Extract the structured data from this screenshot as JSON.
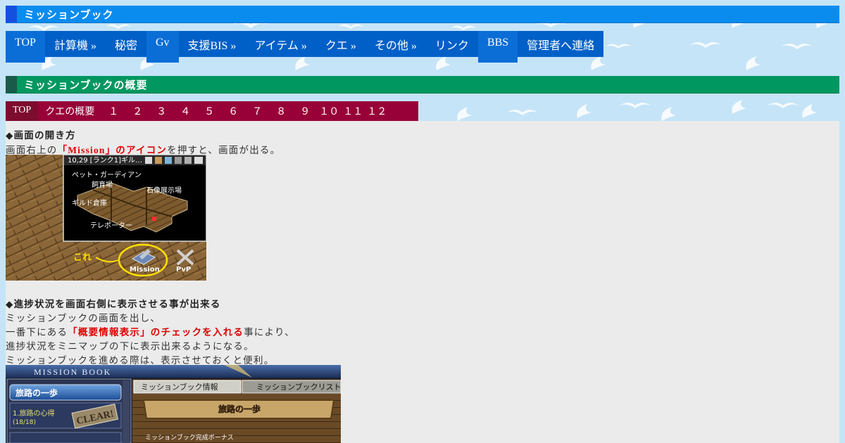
{
  "header": {
    "title": "ミッションブック"
  },
  "nav": {
    "items": [
      {
        "label": "TOP",
        "raised": true
      },
      {
        "label": "計算機 »",
        "raised": false
      },
      {
        "label": "秘密",
        "raised": false
      },
      {
        "label": "Gv",
        "raised": true
      },
      {
        "label": "支援BIS »",
        "raised": false
      },
      {
        "label": "アイテム »",
        "raised": false
      },
      {
        "label": "クエ »",
        "raised": false
      },
      {
        "label": "その他 »",
        "raised": false
      },
      {
        "label": "リンク",
        "raised": false
      },
      {
        "label": "BBS",
        "raised": true
      },
      {
        "label": "管理者へ連絡",
        "raised": false
      }
    ]
  },
  "section": {
    "title": "ミッションブックの概要"
  },
  "subnav": {
    "top": "TOP",
    "overview": "クエの概要",
    "numbers": [
      "１",
      "２",
      "３",
      "４",
      "５",
      "６",
      "７",
      "８",
      "９",
      "１０",
      "１１",
      "１２"
    ]
  },
  "content": {
    "h1": "◆画面の開き方",
    "p1_pre": "画面右上の",
    "p1_red": "「Mission」のアイコン",
    "p1_post": "を押すと、画面が出る。",
    "h2": "◆進捗状況を画面右側に表示させる事が出来る",
    "p2_line1": "ミッションブックの画面を出し、",
    "p2_line2_pre": "一番下にある",
    "p2_line2_red": "「概要情報表示」のチェックを入れる",
    "p2_line2_post": "事により、",
    "p2_line3": "進捗状況をミニマップの下に表示出来るようになる。",
    "p2_line4": "ミッションブックを進める際は、表示させておくと便利。"
  },
  "screenshot1": {
    "window_title": "10,29 [ランク1]ギル…",
    "labels": [
      "ペット・ガーディアン",
      "飼育場",
      "石像展示場",
      "ギルド倉庫",
      "テレポーター"
    ],
    "annotation": "これ",
    "mission_label": "Mission",
    "pvp_label": "PvP"
  },
  "screenshot2": {
    "window_title": "MISSION BOOK",
    "tab1": "ミッションブック情報",
    "tab2": "ミッションブックリスト",
    "left_item": "旅路の一歩",
    "sub_item": "1.旅路の心得",
    "sub_progress": "(18/18)",
    "clear_badge": "CLEAR!",
    "banner": "旅路の一歩",
    "bonus": "ミッションブック完成ボーナス"
  }
}
